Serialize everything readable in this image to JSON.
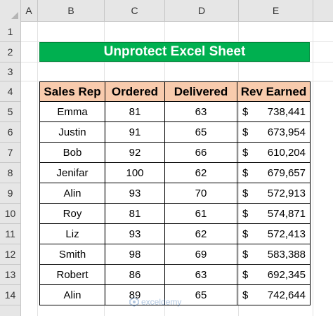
{
  "spreadsheet": {
    "columns": [
      "A",
      "B",
      "C",
      "D",
      "E"
    ],
    "rows": [
      "1",
      "2",
      "3",
      "4",
      "5",
      "6",
      "7",
      "8",
      "9",
      "10",
      "11",
      "12",
      "13",
      "14"
    ]
  },
  "title": "Unprotect Excel Sheet",
  "table": {
    "headers": [
      "Sales Rep",
      "Ordered",
      "Delivered",
      "Rev Earned"
    ],
    "currency_symbol": "$",
    "rows": [
      [
        "Emma",
        "81",
        "63",
        "738,441"
      ],
      [
        "Justin",
        "91",
        "65",
        "673,954"
      ],
      [
        "Bob",
        "92",
        "66",
        "610,204"
      ],
      [
        "Jenifar",
        "100",
        "62",
        "679,657"
      ],
      [
        "Alin",
        "93",
        "70",
        "572,913"
      ],
      [
        "Roy",
        "81",
        "61",
        "574,871"
      ],
      [
        "Liz",
        "93",
        "62",
        "572,413"
      ],
      [
        "Smith",
        "98",
        "69",
        "583,388"
      ],
      [
        "Robert",
        "86",
        "63",
        "692,345"
      ],
      [
        "Alin",
        "89",
        "65",
        "742,644"
      ]
    ]
  },
  "watermark": {
    "text": "exceldemy",
    "icon": "exceldemy-logo-icon"
  },
  "colors": {
    "title_fill": "#00b050",
    "header_fill": "#f8cbad",
    "sheet_header_fill": "#e6e6e6"
  }
}
